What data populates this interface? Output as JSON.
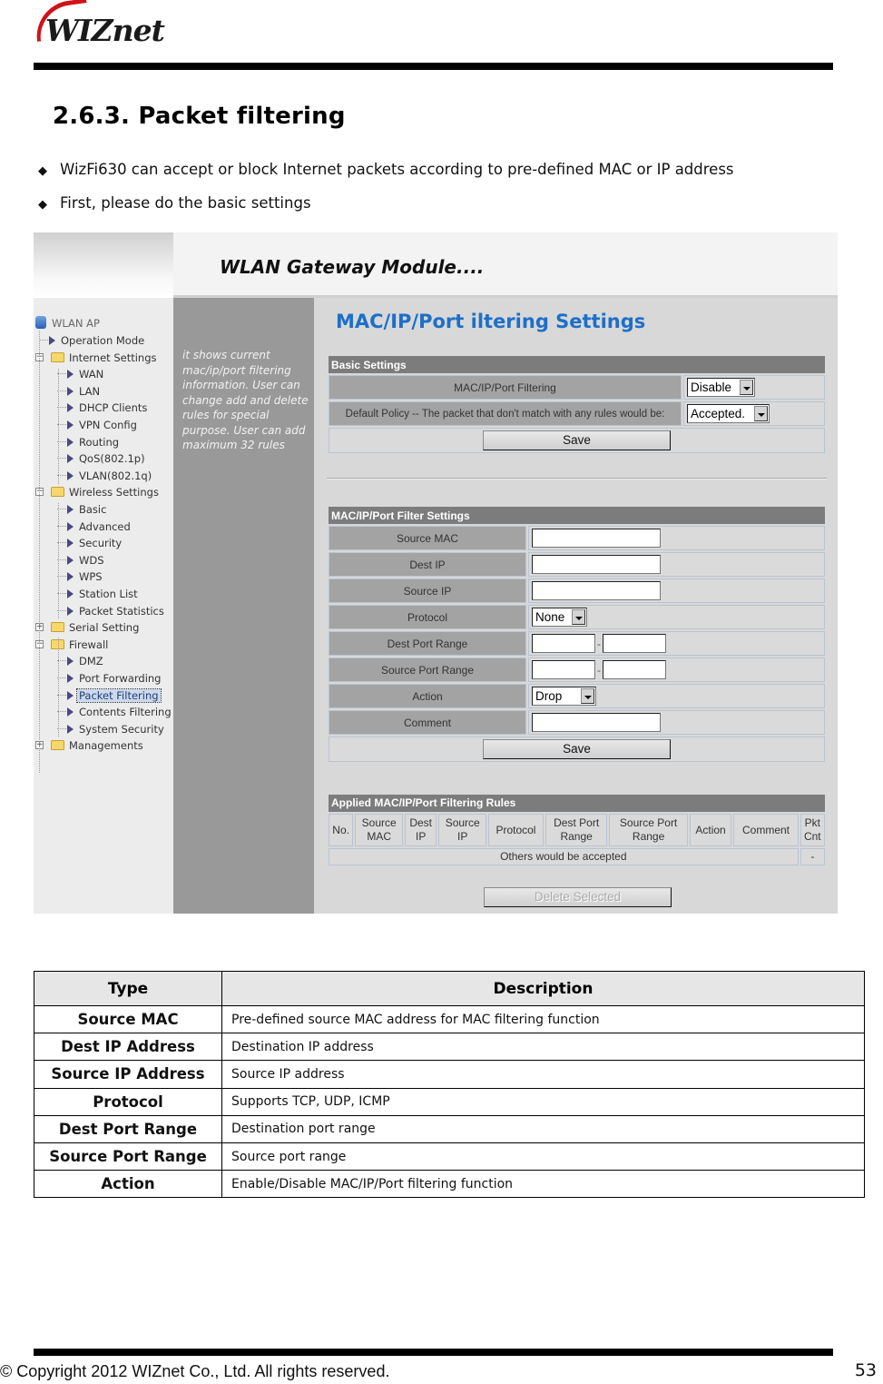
{
  "header": {
    "logo_text": "WIZnet"
  },
  "section": {
    "title": "2.6.3.  Packet  filtering",
    "bullets": [
      "WizFi630 can accept or block Internet packets according to pre-defined MAC or IP address",
      "First, please do the basic settings"
    ],
    "bullet_glyph": "◆"
  },
  "screenshot": {
    "banner_title": "WLAN Gateway Module....",
    "tree": {
      "root": "WLAN AP",
      "items": [
        {
          "label": "Operation Mode",
          "level": 1,
          "type": "leaf"
        },
        {
          "label": "Internet Settings",
          "level": 0,
          "type": "folder",
          "expanded": true
        },
        {
          "label": "WAN",
          "level": 2,
          "type": "leaf"
        },
        {
          "label": "LAN",
          "level": 2,
          "type": "leaf"
        },
        {
          "label": "DHCP Clients",
          "level": 2,
          "type": "leaf"
        },
        {
          "label": "VPN Config",
          "level": 2,
          "type": "leaf"
        },
        {
          "label": "Routing",
          "level": 2,
          "type": "leaf"
        },
        {
          "label": "QoS(802.1p)",
          "level": 2,
          "type": "leaf"
        },
        {
          "label": "VLAN(802.1q)",
          "level": 2,
          "type": "leaf"
        },
        {
          "label": "Wireless Settings",
          "level": 0,
          "type": "folder",
          "expanded": true
        },
        {
          "label": "Basic",
          "level": 2,
          "type": "leaf"
        },
        {
          "label": "Advanced",
          "level": 2,
          "type": "leaf"
        },
        {
          "label": "Security",
          "level": 2,
          "type": "leaf"
        },
        {
          "label": "WDS",
          "level": 2,
          "type": "leaf"
        },
        {
          "label": "WPS",
          "level": 2,
          "type": "leaf"
        },
        {
          "label": "Station List",
          "level": 2,
          "type": "leaf"
        },
        {
          "label": "Packet Statistics",
          "level": 2,
          "type": "leaf"
        },
        {
          "label": "Serial Setting",
          "level": 0,
          "type": "folder",
          "expanded": false
        },
        {
          "label": "Firewall",
          "level": 0,
          "type": "folder",
          "expanded": true
        },
        {
          "label": "DMZ",
          "level": 2,
          "type": "leaf"
        },
        {
          "label": "Port Forwarding",
          "level": 2,
          "type": "leaf"
        },
        {
          "label": "Packet Filtering",
          "level": 2,
          "type": "leaf",
          "selected": true
        },
        {
          "label": "Contents Filtering",
          "level": 2,
          "type": "leaf"
        },
        {
          "label": "System Security",
          "level": 2,
          "type": "leaf"
        },
        {
          "label": "Managements",
          "level": 0,
          "type": "folder",
          "expanded": false
        }
      ]
    },
    "help_text": "it shows current mac/ip/port filtering information. User can change add and delete rules for special purpose. User can add maximum 32 rules",
    "page_title": "MAC/IP/Port iltering Settings",
    "basic_settings": {
      "header": "Basic Settings",
      "filtering_label": "MAC/IP/Port Filtering",
      "filtering_value": "Disable",
      "policy_label": "Default Policy -- The packet that don't match with any rules would be:",
      "policy_value": "Accepted.",
      "save_label": "Save"
    },
    "filter_settings": {
      "header": "MAC/IP/Port Filter Settings",
      "source_mac_label": "Source MAC",
      "source_mac_value": "",
      "dest_ip_label": "Dest IP",
      "dest_ip_value": "",
      "source_ip_label": "Source IP",
      "source_ip_value": "",
      "protocol_label": "Protocol",
      "protocol_value": "None",
      "dest_port_label": "Dest Port Range",
      "dest_port_from": "",
      "dest_port_to": "",
      "source_port_label": "Source Port Range",
      "source_port_from": "",
      "source_port_to": "",
      "range_separator": "-",
      "action_label": "Action",
      "action_value": "Drop",
      "comment_label": "Comment",
      "comment_value": "",
      "save_label": "Save"
    },
    "rules": {
      "header": "Applied MAC/IP/Port Filtering Rules",
      "columns": [
        [
          "No."
        ],
        [
          "Source",
          "MAC"
        ],
        [
          "Dest",
          "IP"
        ],
        [
          "Source",
          "IP"
        ],
        [
          "Protocol"
        ],
        [
          "Dest Port",
          "Range"
        ],
        [
          "Source Port",
          "Range"
        ],
        [
          "Action"
        ],
        [
          "Comment"
        ],
        [
          "Pkt",
          "Cnt"
        ]
      ],
      "default_row_text": "Others would be accepted",
      "default_row_count": "-",
      "delete_label": "Delete Selected"
    }
  },
  "description_table": {
    "headers": [
      "Type",
      "Description"
    ],
    "rows": [
      {
        "type": "Source MAC",
        "description": "Pre-defined source MAC address for MAC filtering function"
      },
      {
        "type": "Dest IP Address",
        "description": "Destination IP address"
      },
      {
        "type": "Source IP Address",
        "description": "Source IP address"
      },
      {
        "type": "Protocol",
        "description": "Supports TCP, UDP, ICMP"
      },
      {
        "type": "Dest Port Range",
        "description": "Destination port range"
      },
      {
        "type": "Source Port Range",
        "description": "Source port range"
      },
      {
        "type": "Action",
        "description": "Enable/Disable MAC/IP/Port filtering function"
      }
    ]
  },
  "footer": {
    "copyright": "© Copyright 2012 WIZnet Co., Ltd. All rights reserved.",
    "page_number": "53"
  },
  "colors": {
    "logo_red": "#d0121b",
    "title_blue": "#1d6fc9",
    "section_header_gray": "#7c7c7c",
    "help_panel_gray": "#999999"
  }
}
